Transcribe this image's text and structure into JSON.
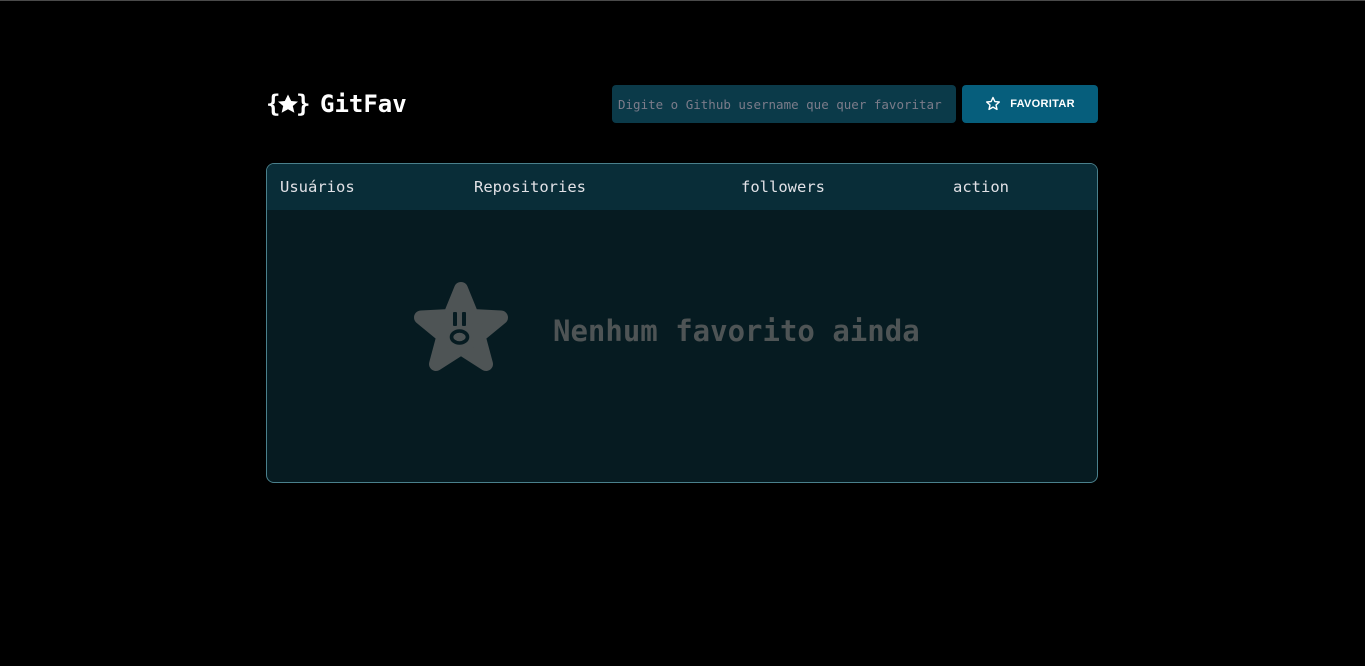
{
  "app": {
    "name": "GitFav",
    "logo_icon": "star-braces-icon"
  },
  "search": {
    "placeholder": "Digite o Github username que quer favoritar",
    "value": ""
  },
  "favorite_button": {
    "label": "FAVORITAR",
    "icon": "star-outline-icon"
  },
  "table": {
    "columns": [
      "Usuários",
      "Repositories",
      "followers",
      "action"
    ],
    "rows": []
  },
  "empty_state": {
    "icon": "surprised-star-icon",
    "message": "Nenhum favorito ainda"
  },
  "colors": {
    "background": "#000000",
    "input_bg": "#0b3a49",
    "button_bg": "#065e7c",
    "table_header_bg": "#092d38",
    "table_body_bg": "#061b21",
    "table_border": "#4a808c",
    "empty_text": "#4e5455"
  }
}
